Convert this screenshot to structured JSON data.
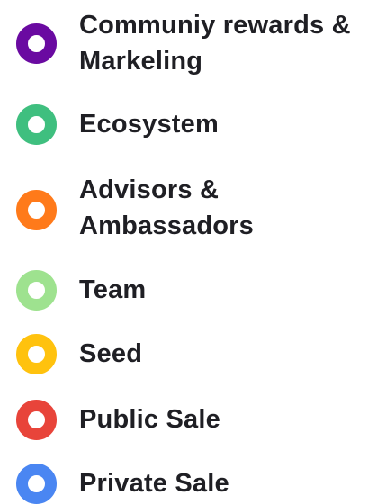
{
  "chart_data": {
    "type": "pie",
    "title": "",
    "legend": {
      "placement": "left-column",
      "entries": [
        {
          "label": "Communiy rewards & Markeling",
          "color": "#6a0aa1"
        },
        {
          "label": "Ecosystem",
          "color": "#3fbf7f"
        },
        {
          "label": "Advisors & Ambassadors",
          "color": "#ff7a1a"
        },
        {
          "label": "Team",
          "color": "#9ee28f"
        },
        {
          "label": "Seed",
          "color": "#ffc20e"
        },
        {
          "label": "Public Sale",
          "color": "#e8443a"
        },
        {
          "label": "Private Sale",
          "color": "#4a86f2"
        }
      ]
    }
  }
}
